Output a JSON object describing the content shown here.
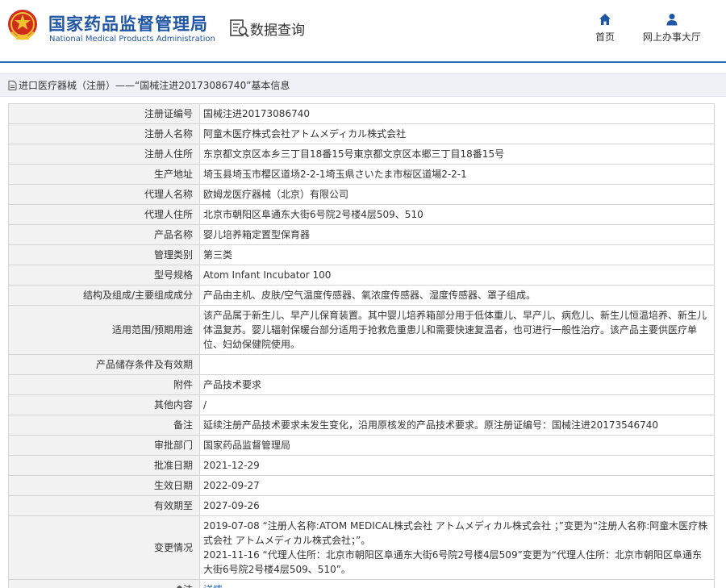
{
  "header": {
    "brand_cn": "国家药品监督管理局",
    "brand_en": "National Medical Products Administration",
    "data_query": "数据查询",
    "nav": [
      {
        "label": "首页",
        "icon": "home-icon"
      },
      {
        "label": "网上办事大厅",
        "icon": "user-icon"
      }
    ],
    "colors": {
      "brand": "#1f57a6",
      "accent": "#2a6fb5",
      "emblem_red": "#d12b1e",
      "emblem_gold": "#f2c230"
    }
  },
  "breadcrumb": {
    "text": "进口医疗器械（注册）——“国械注进20173086740”基本信息",
    "icon": "document-icon"
  },
  "rows": [
    {
      "label": "注册证编号",
      "value": "国械注进20173086740"
    },
    {
      "label": "注册人名称",
      "value": "阿童木医疗株式会社アトムメディカル株式会社"
    },
    {
      "label": "注册人住所",
      "value": "东京都文京区本乡三丁目18番15号東京都文京区本郷三丁目18番15号"
    },
    {
      "label": "生产地址",
      "value": "埼玉县埼玉市樱区道场2-2-1埼玉県さいたま市桜区道場2-2-1"
    },
    {
      "label": "代理人名称",
      "value": "欧姆龙医疗器械（北京）有限公司"
    },
    {
      "label": "代理人住所",
      "value": "北京市朝阳区阜通东大街6号院2号楼4层509、510"
    },
    {
      "label": "产品名称",
      "value": "婴儿培养箱定置型保育器"
    },
    {
      "label": "管理类别",
      "value": "第三类"
    },
    {
      "label": "型号规格",
      "value": "Atom Infant Incubator 100"
    },
    {
      "label": "结构及组成/主要组成成分",
      "value": "产品由主机、皮肤/空气温度传感器、氧浓度传感器、湿度传感器、罩子组成。"
    },
    {
      "label": "适用范围/预期用途",
      "value": "该产品属于新生儿、早产儿保育装置。其中婴儿培养箱部分用于低体重儿、早产儿、病危儿、新生儿恒温培养、新生儿体温复苏。婴儿辐射保暖台部分适用于抢救危重患儿和需要快速复温者，也可进行一般性治疗。该产品主要供医疗单位、妇幼保健院使用。"
    },
    {
      "label": "产品储存条件及有效期",
      "value": ""
    },
    {
      "label": "附件",
      "value": "产品技术要求"
    },
    {
      "label": "其他内容",
      "value": "/"
    },
    {
      "label": "备注",
      "value": "延续注册产品技术要求未发生变化，沿用原核发的产品技术要求。原注册证编号：国械注进20173546740"
    },
    {
      "label": "审批部门",
      "value": "国家药品监督管理局"
    },
    {
      "label": "批准日期",
      "value": "2021-12-29"
    },
    {
      "label": "生效日期",
      "value": "2022-09-27"
    },
    {
      "label": "有效期至",
      "value": "2027-09-26"
    }
  ],
  "change": {
    "label": "变更情况",
    "entries": [
      "2019-07-08 “注册人名称:ATOM MEDICAL株式会社 アトムメディカル株式会社 ；”变更为“注册人名称:阿童木医疗株式会社 アトムメディカル株式会社；”。",
      "2021-11-16 “代理人住所：北京市朝阳区阜通东大街6号院2号楼4层509”变更为“代理人住所：北京市朝阳区阜通东大街6号院2号楼4层509、510”。"
    ]
  },
  "note": {
    "label": "注",
    "icon": "pin-icon",
    "link": "详情"
  }
}
